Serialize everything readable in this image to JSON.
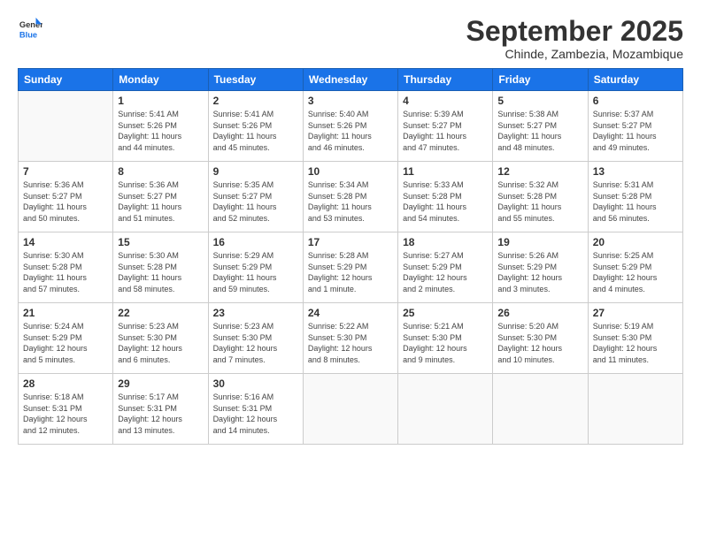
{
  "logo": {
    "general": "General",
    "blue": "Blue"
  },
  "header": {
    "month": "September 2025",
    "location": "Chinde, Zambezia, Mozambique"
  },
  "weekdays": [
    "Sunday",
    "Monday",
    "Tuesday",
    "Wednesday",
    "Thursday",
    "Friday",
    "Saturday"
  ],
  "weeks": [
    [
      {
        "day": "",
        "info": ""
      },
      {
        "day": "1",
        "info": "Sunrise: 5:41 AM\nSunset: 5:26 PM\nDaylight: 11 hours\nand 44 minutes."
      },
      {
        "day": "2",
        "info": "Sunrise: 5:41 AM\nSunset: 5:26 PM\nDaylight: 11 hours\nand 45 minutes."
      },
      {
        "day": "3",
        "info": "Sunrise: 5:40 AM\nSunset: 5:26 PM\nDaylight: 11 hours\nand 46 minutes."
      },
      {
        "day": "4",
        "info": "Sunrise: 5:39 AM\nSunset: 5:27 PM\nDaylight: 11 hours\nand 47 minutes."
      },
      {
        "day": "5",
        "info": "Sunrise: 5:38 AM\nSunset: 5:27 PM\nDaylight: 11 hours\nand 48 minutes."
      },
      {
        "day": "6",
        "info": "Sunrise: 5:37 AM\nSunset: 5:27 PM\nDaylight: 11 hours\nand 49 minutes."
      }
    ],
    [
      {
        "day": "7",
        "info": "Sunrise: 5:36 AM\nSunset: 5:27 PM\nDaylight: 11 hours\nand 50 minutes."
      },
      {
        "day": "8",
        "info": "Sunrise: 5:36 AM\nSunset: 5:27 PM\nDaylight: 11 hours\nand 51 minutes."
      },
      {
        "day": "9",
        "info": "Sunrise: 5:35 AM\nSunset: 5:27 PM\nDaylight: 11 hours\nand 52 minutes."
      },
      {
        "day": "10",
        "info": "Sunrise: 5:34 AM\nSunset: 5:28 PM\nDaylight: 11 hours\nand 53 minutes."
      },
      {
        "day": "11",
        "info": "Sunrise: 5:33 AM\nSunset: 5:28 PM\nDaylight: 11 hours\nand 54 minutes."
      },
      {
        "day": "12",
        "info": "Sunrise: 5:32 AM\nSunset: 5:28 PM\nDaylight: 11 hours\nand 55 minutes."
      },
      {
        "day": "13",
        "info": "Sunrise: 5:31 AM\nSunset: 5:28 PM\nDaylight: 11 hours\nand 56 minutes."
      }
    ],
    [
      {
        "day": "14",
        "info": "Sunrise: 5:30 AM\nSunset: 5:28 PM\nDaylight: 11 hours\nand 57 minutes."
      },
      {
        "day": "15",
        "info": "Sunrise: 5:30 AM\nSunset: 5:28 PM\nDaylight: 11 hours\nand 58 minutes."
      },
      {
        "day": "16",
        "info": "Sunrise: 5:29 AM\nSunset: 5:29 PM\nDaylight: 11 hours\nand 59 minutes."
      },
      {
        "day": "17",
        "info": "Sunrise: 5:28 AM\nSunset: 5:29 PM\nDaylight: 12 hours\nand 1 minute."
      },
      {
        "day": "18",
        "info": "Sunrise: 5:27 AM\nSunset: 5:29 PM\nDaylight: 12 hours\nand 2 minutes."
      },
      {
        "day": "19",
        "info": "Sunrise: 5:26 AM\nSunset: 5:29 PM\nDaylight: 12 hours\nand 3 minutes."
      },
      {
        "day": "20",
        "info": "Sunrise: 5:25 AM\nSunset: 5:29 PM\nDaylight: 12 hours\nand 4 minutes."
      }
    ],
    [
      {
        "day": "21",
        "info": "Sunrise: 5:24 AM\nSunset: 5:29 PM\nDaylight: 12 hours\nand 5 minutes."
      },
      {
        "day": "22",
        "info": "Sunrise: 5:23 AM\nSunset: 5:30 PM\nDaylight: 12 hours\nand 6 minutes."
      },
      {
        "day": "23",
        "info": "Sunrise: 5:23 AM\nSunset: 5:30 PM\nDaylight: 12 hours\nand 7 minutes."
      },
      {
        "day": "24",
        "info": "Sunrise: 5:22 AM\nSunset: 5:30 PM\nDaylight: 12 hours\nand 8 minutes."
      },
      {
        "day": "25",
        "info": "Sunrise: 5:21 AM\nSunset: 5:30 PM\nDaylight: 12 hours\nand 9 minutes."
      },
      {
        "day": "26",
        "info": "Sunrise: 5:20 AM\nSunset: 5:30 PM\nDaylight: 12 hours\nand 10 minutes."
      },
      {
        "day": "27",
        "info": "Sunrise: 5:19 AM\nSunset: 5:30 PM\nDaylight: 12 hours\nand 11 minutes."
      }
    ],
    [
      {
        "day": "28",
        "info": "Sunrise: 5:18 AM\nSunset: 5:31 PM\nDaylight: 12 hours\nand 12 minutes."
      },
      {
        "day": "29",
        "info": "Sunrise: 5:17 AM\nSunset: 5:31 PM\nDaylight: 12 hours\nand 13 minutes."
      },
      {
        "day": "30",
        "info": "Sunrise: 5:16 AM\nSunset: 5:31 PM\nDaylight: 12 hours\nand 14 minutes."
      },
      {
        "day": "",
        "info": ""
      },
      {
        "day": "",
        "info": ""
      },
      {
        "day": "",
        "info": ""
      },
      {
        "day": "",
        "info": ""
      }
    ]
  ]
}
